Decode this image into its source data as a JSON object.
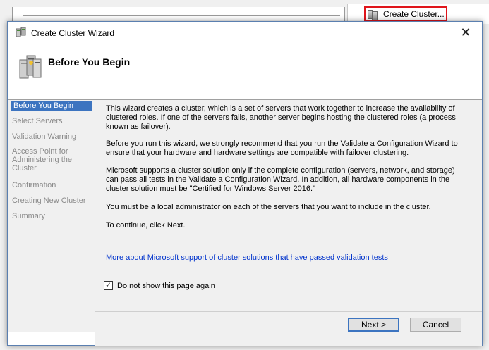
{
  "background": {
    "action_label": "Create Cluster..."
  },
  "dialog": {
    "title": "Create Cluster Wizard",
    "close_glyph": "✕",
    "header_title": "Before You Begin"
  },
  "nav": {
    "items": [
      "Before You Begin",
      "Select Servers",
      "Validation Warning",
      "Access Point for Administering the Cluster",
      "Confirmation",
      "Creating New Cluster",
      "Summary"
    ]
  },
  "content": {
    "paragraphs": [
      "This wizard creates a cluster, which is a set of servers that work together to increase the availability of clustered roles. If one of the servers fails, another server begins hosting the clustered roles (a process known as failover).",
      "Before you run this wizard, we strongly recommend that you run the Validate a Configuration Wizard to ensure that your hardware and hardware settings are compatible with failover clustering.",
      "Microsoft supports a cluster solution only if the complete configuration (servers, network, and storage) can pass all tests in the Validate a Configuration Wizard. In addition, all hardware components in the cluster solution must be \"Certified for Windows Server 2016.\"",
      "You must be a local administrator on each of the servers that you want to include in the cluster.",
      "To continue, click Next."
    ],
    "link_text": "More about Microsoft support of cluster solutions that have passed validation tests",
    "checkbox_label": "Do not show this page again",
    "checkbox_checked": true,
    "checkbox_glyph": "✓"
  },
  "buttons": {
    "next": "Next >",
    "cancel": "Cancel"
  },
  "colors": {
    "selection": "#3c74c0",
    "link": "#0033cc",
    "highlight": "#e0151b"
  }
}
